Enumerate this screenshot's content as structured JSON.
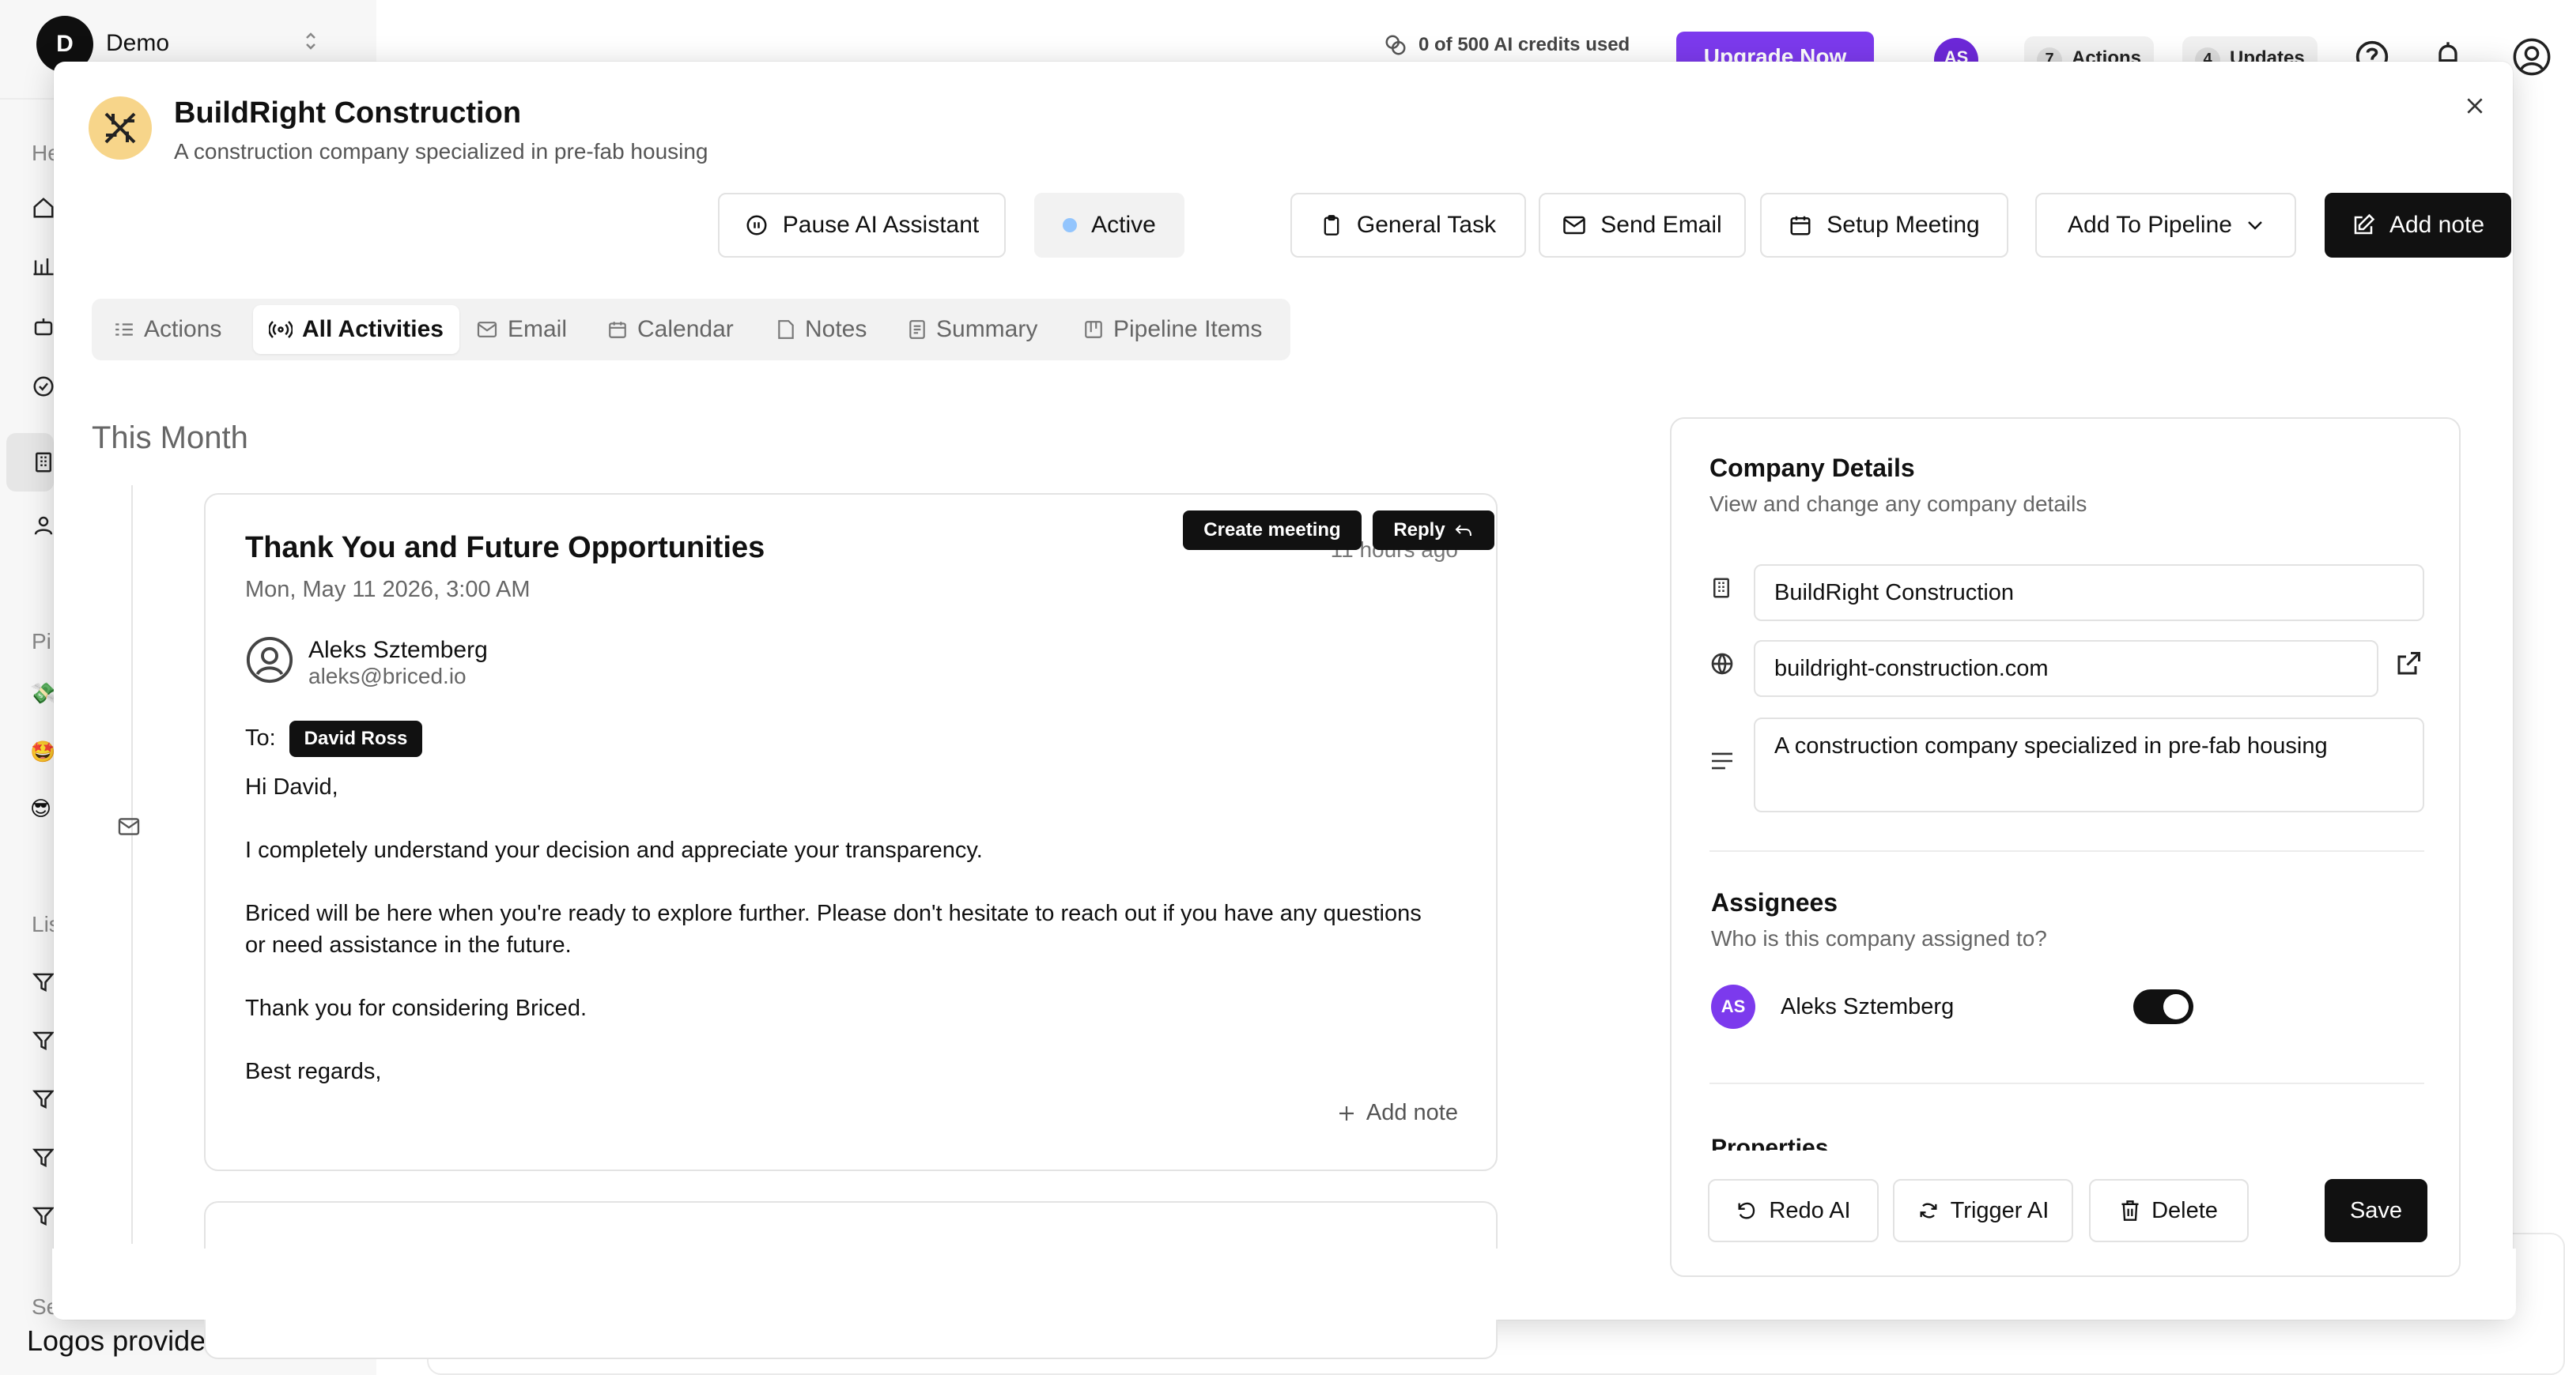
{
  "background": {
    "workspace": {
      "initial": "D",
      "name": "Demo"
    },
    "sidebar_sections": [
      "He",
      "Pi",
      "Lis",
      "Se"
    ],
    "footer_note": "Logos provided by Logo.dev",
    "topbar": {
      "credits": "0 of 500 AI credits used",
      "upgrade_label": "Upgrade Now",
      "avatar_initials": "AS",
      "actions_count": "7",
      "actions_label": "Actions",
      "updates_count": "4",
      "updates_label": "Updates"
    }
  },
  "modal": {
    "company_name": "BuildRight Construction",
    "company_description": "A construction company specialized in pre-fab housing",
    "actions": {
      "pause_ai": "Pause AI Assistant",
      "status": "Active",
      "general_task": "General Task",
      "send_email": "Send Email",
      "setup_meeting": "Setup Meeting",
      "add_to_pipeline": "Add To Pipeline",
      "add_note": "Add note"
    },
    "tabs": [
      {
        "label": "Actions"
      },
      {
        "label": "All Activities"
      },
      {
        "label": "Email"
      },
      {
        "label": "Calendar"
      },
      {
        "label": "Notes"
      },
      {
        "label": "Summary"
      },
      {
        "label": "Pipeline Items"
      }
    ],
    "active_tab": "All Activities",
    "section_heading": "This Month",
    "email": {
      "title": "Thank You and Future Opportunities",
      "date": "Mon, May 11 2026, 3:00 AM",
      "time_ago": "11 hours ago",
      "create_meeting_label": "Create meeting",
      "reply_label": "Reply",
      "sender_name": "Aleks Sztemberg",
      "sender_email": "aleks@briced.io",
      "to_label": "To:",
      "recipient": "David Ross",
      "body": {
        "greeting": "Hi David,",
        "p1": "I completely understand your decision and appreciate your transparency.",
        "p2a": "Briced will be here when you're ready to explore further. Please don't hesitate to reach out if you have any questions",
        "p2b": "or need assistance in the future.",
        "p3": "Thank you for considering Briced.",
        "signoff": "Best regards,"
      },
      "add_note_label": "Add note"
    },
    "company_details": {
      "title": "Company Details",
      "subtitle": "View and change any company details",
      "name_value": "BuildRight Construction",
      "website_value": "buildright-construction.com",
      "description_value": "A construction company specialized in pre-fab housing"
    },
    "assignees": {
      "title": "Assignees",
      "subtitle": "Who is this company assigned to?",
      "people": [
        {
          "initials": "AS",
          "name": "Aleks Sztemberg",
          "assigned": true
        }
      ]
    },
    "properties_heading": "Properties",
    "footer_actions": {
      "redo_ai": "Redo AI",
      "trigger_ai": "Trigger AI",
      "delete": "Delete",
      "save": "Save"
    }
  }
}
